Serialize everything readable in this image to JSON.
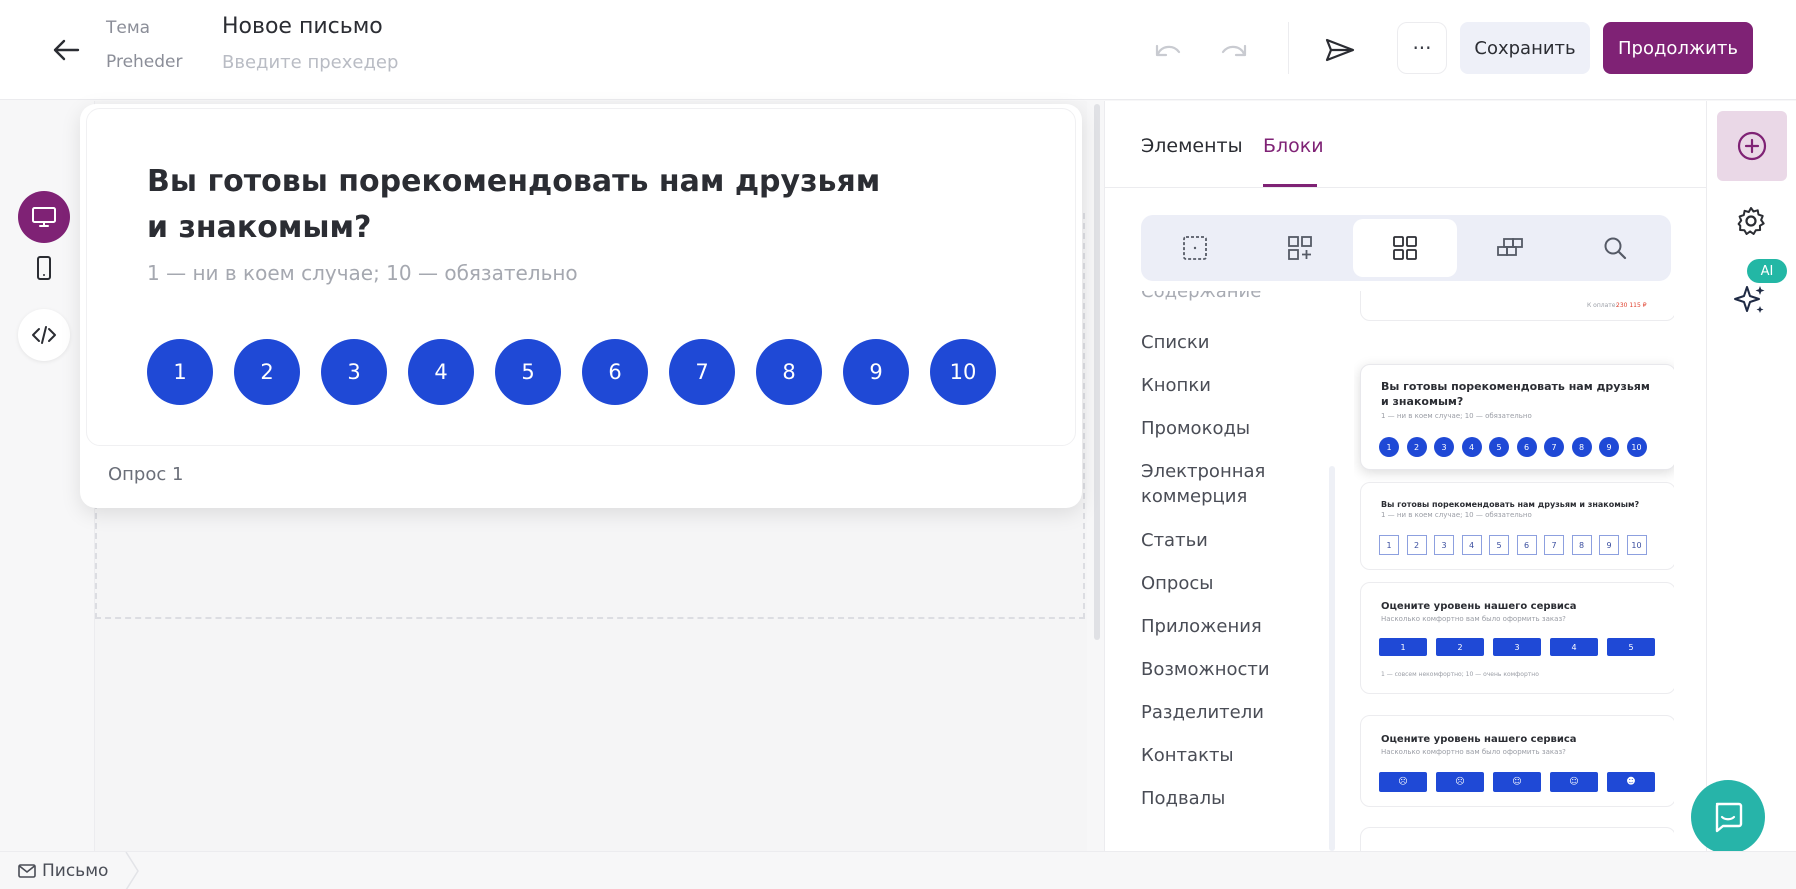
{
  "header": {
    "subject_label": "Тема",
    "subject_value": "Новое письмо",
    "preheader_label": "Preheder",
    "preheader_placeholder": "Введите прехедер",
    "more_label": "···",
    "save_label": "Сохранить",
    "continue_label": "Продолжить"
  },
  "survey": {
    "title": "Вы готовы порекомендовать нам друзьям и знакомым?",
    "subtitle": "1 — ни в коем случае; 10 — обязательно",
    "options": [
      "1",
      "2",
      "3",
      "4",
      "5",
      "6",
      "7",
      "8",
      "9",
      "10"
    ],
    "caption": "Опрос 1"
  },
  "panel": {
    "tabs": [
      "Элементы",
      "Блоки"
    ],
    "active_tab": "Блоки",
    "categories": [
      "Содержание",
      "Списки",
      "Кнопки",
      "Промокоды",
      "Электронная коммерция",
      "Статьи",
      "Опросы",
      "Приложения",
      "Возможности",
      "Разделители",
      "Контакты",
      "Подвалы"
    ],
    "thumb0": {
      "label": "К оплате:",
      "price": "230 115 ₽"
    },
    "thumb1": {
      "title": "Вы готовы порекомендовать нам друзьям и знакомым?",
      "subtitle": "1 — ни в коем случае; 10 — обязательно"
    },
    "thumb2": {
      "title": "Вы готовы порекомендовать нам друзьям и знакомым?",
      "subtitle": "1 — ни в коем случае; 10 — обязательно"
    },
    "thumb3": {
      "title": "Оцените уровень нашего сервиса",
      "subtitle": "Насколько комфортно вам было оформить заказ?",
      "options": [
        "1",
        "2",
        "3",
        "4",
        "5"
      ],
      "footnote": "1 — совсем некомфортно; 10 — очень комфортно"
    },
    "thumb4": {
      "title": "Оцените уровень нашего сервиса",
      "subtitle": "Насколько комфортно вам было оформить заказ?",
      "options": [
        "☹",
        "☹",
        "☺",
        "☺",
        "☻"
      ]
    }
  },
  "right_rail": {
    "ai_label": "AI"
  },
  "status": {
    "label": "Письмо"
  },
  "colors": {
    "accent": "#7f2275",
    "survey_blue": "#1f49d6",
    "chat": "#27b4a9",
    "ai_badge": "#23b7a5"
  },
  "icons": [
    "back-arrow-icon",
    "undo-icon",
    "redo-icon",
    "send-icon",
    "desktop-icon",
    "mobile-icon",
    "code-icon",
    "grid-icon",
    "add-block-icon",
    "blocks-icon",
    "layout-icon",
    "search-icon",
    "add-circle-icon",
    "gear-icon",
    "sparkle-icon",
    "chat-icon",
    "mail-icon"
  ]
}
